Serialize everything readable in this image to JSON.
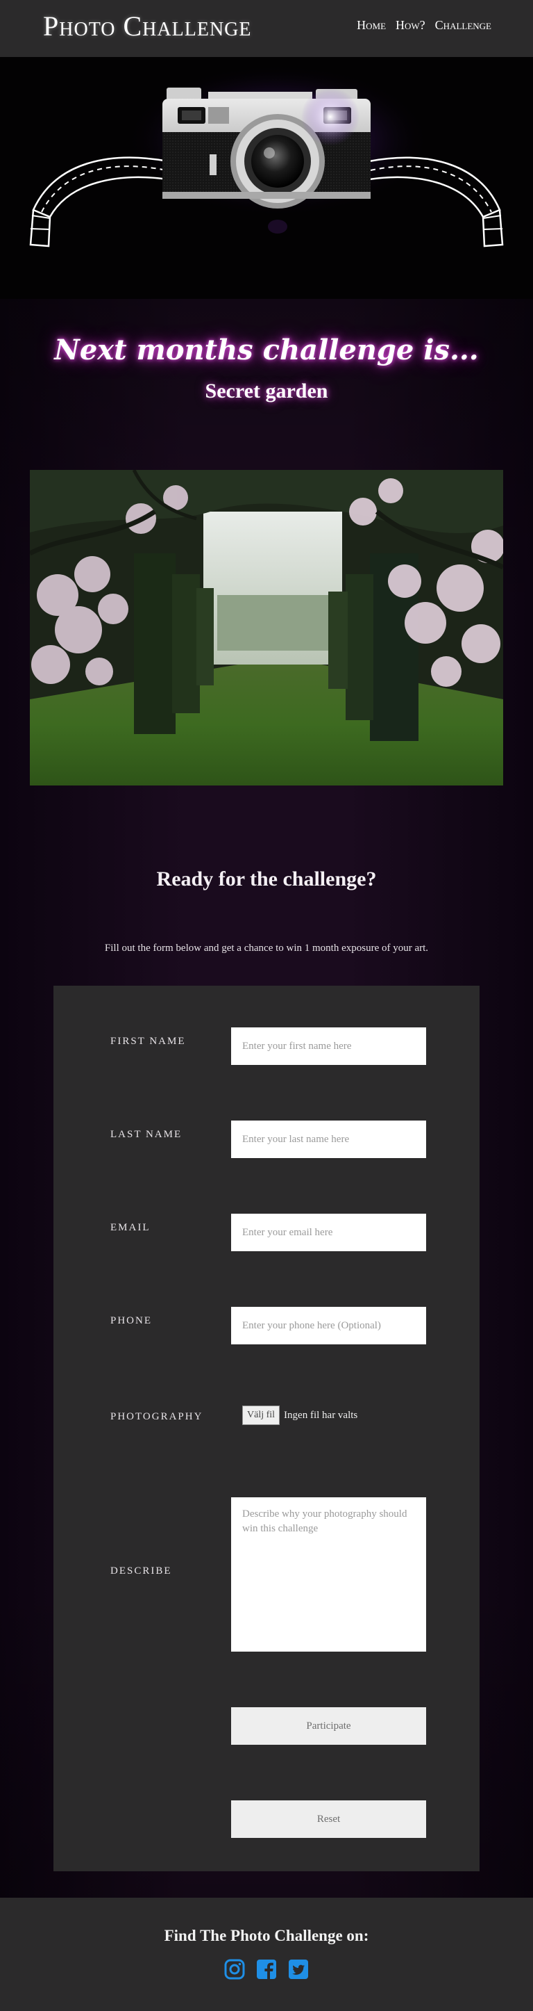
{
  "header": {
    "title": "Photo Challenge",
    "nav": [
      {
        "label": "Home"
      },
      {
        "label": "How?"
      },
      {
        "label": "Challenge"
      }
    ]
  },
  "challenge": {
    "heading": "Next months challenge is...",
    "theme": "Secret garden"
  },
  "signup": {
    "heading": "Ready for the challenge?",
    "subtext": "Fill out the form below and get a chance to win 1 month exposure of your art."
  },
  "form": {
    "first_name": {
      "label": "First name",
      "placeholder": "Enter your first name here",
      "value": ""
    },
    "last_name": {
      "label": "Last name",
      "placeholder": "Enter your last name here",
      "value": ""
    },
    "email": {
      "label": "Email",
      "placeholder": "Enter your email here",
      "value": ""
    },
    "phone": {
      "label": "Phone",
      "placeholder": "Enter your phone here (Optional)",
      "value": ""
    },
    "photography": {
      "label": "Photography",
      "button_label": "Välj fil",
      "status": "Ingen fil har valts"
    },
    "describe": {
      "label": "Describe",
      "placeholder": "Describe why your photography should win this challenge",
      "value": ""
    },
    "participate_label": "Participate",
    "reset_label": "Reset"
  },
  "footer": {
    "heading": "Find The Photo Challenge on:",
    "social": [
      "instagram-icon",
      "facebook-icon",
      "twitter-icon"
    ]
  },
  "colors": {
    "header_bg": "#2b2a2b",
    "glow_accent": "#d74fd7",
    "social_blue": "#1f8fe6"
  }
}
